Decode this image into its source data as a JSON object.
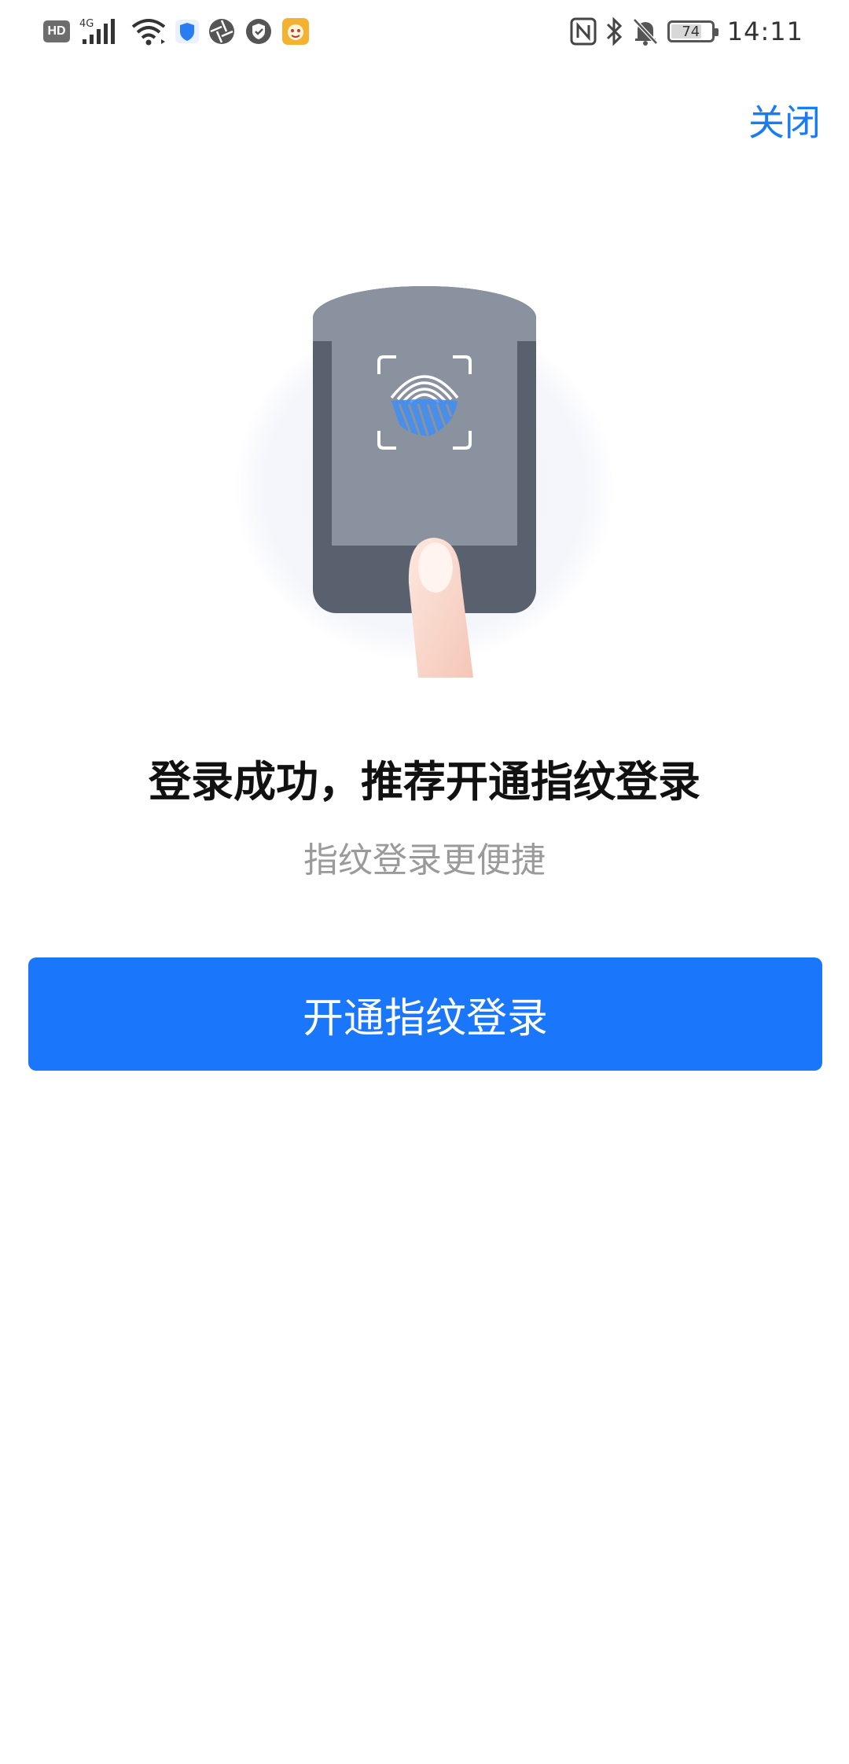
{
  "status_bar": {
    "left_icons": [
      "hd-icon",
      "signal-4g-icon",
      "wifi-icon",
      "shield-blue-icon",
      "aperture-icon",
      "shield-check-icon",
      "app-notification-icon"
    ],
    "hd_label": "HD",
    "network_label": "4G",
    "right_icons": [
      "nfc-icon",
      "bluetooth-icon",
      "mute-bell-icon",
      "battery-icon"
    ],
    "battery_level": "74",
    "time": "14:11"
  },
  "header": {
    "close_label": "关闭"
  },
  "main": {
    "title": "登录成功，推荐开通指纹登录",
    "subtitle": "指纹登录更便捷",
    "button_label": "开通指纹登录"
  },
  "colors": {
    "accent": "#1a77fb",
    "link": "#1a7cf5",
    "title": "#111111",
    "subtitle": "#9a9a9a"
  }
}
